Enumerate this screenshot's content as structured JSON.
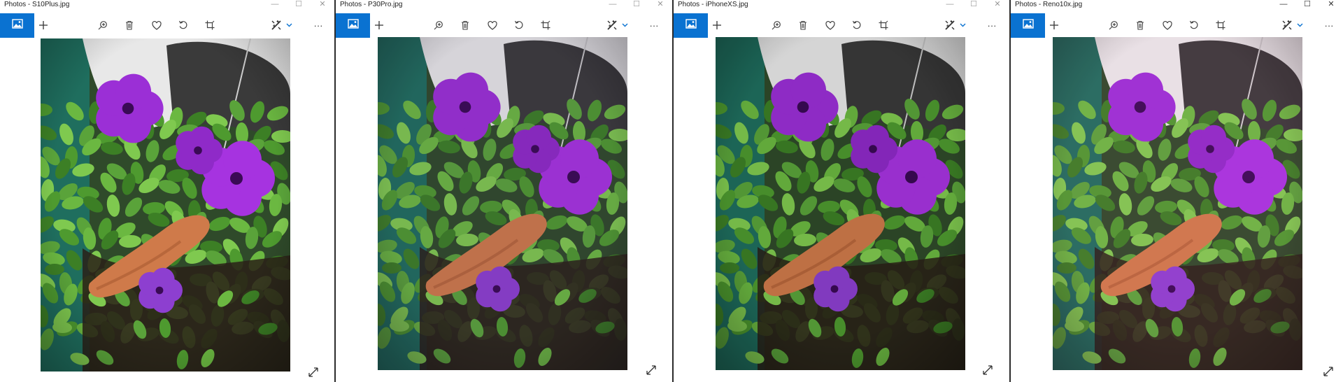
{
  "windows": [
    {
      "title": "Photos - S10Plus.jpg",
      "active": false
    },
    {
      "title": "Photos - P30Pro.jpg",
      "active": false
    },
    {
      "title": "Photos - iPhoneXS.jpg",
      "active": false
    },
    {
      "title": "Photos - Reno10x.jpg",
      "active": true
    }
  ],
  "window_controls": {
    "minimize": "—",
    "maximize": "☐",
    "close": "✕"
  },
  "toolbar": {
    "icons": [
      "collection-icon",
      "add-icon",
      "zoom-icon",
      "delete-icon",
      "favorite-icon",
      "rotate-icon",
      "crop-icon",
      "edit-create-icon",
      "chevron-down-icon",
      "more-icon"
    ],
    "more_label": "···"
  },
  "colors": {
    "accent": "#0a72d1",
    "petunia": "#9b2fd6",
    "foliage": "#5aa33a",
    "figurine": "#cf7a4a",
    "soil": "#2a2018",
    "pot": "#e8e8e8"
  }
}
